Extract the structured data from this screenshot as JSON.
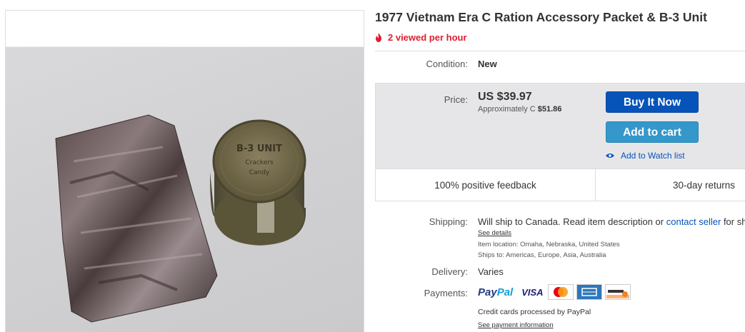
{
  "listing": {
    "title": "1977 Vietnam Era C Ration Accessory Packet & B-3 Unit",
    "views": "2 viewed per hour"
  },
  "condition": {
    "label": "Condition:",
    "value": "New"
  },
  "price": {
    "label": "Price:",
    "main": "US $39.97",
    "approx_prefix": "Approximately C ",
    "approx_value": "$51.86"
  },
  "actions": {
    "buy_now": "Buy It Now",
    "add_to_cart": "Add to cart",
    "watch": "Add to Watch list"
  },
  "highlights": {
    "feedback": "100% positive feedback",
    "returns": "30-day returns"
  },
  "shipping": {
    "label": "Shipping:",
    "text": "Will ship to Canada. Read item description or ",
    "contact_link": "contact seller",
    "text_after": " for sh",
    "see_details": "See details",
    "item_location": "Item location:  Omaha, Nebraska, United States",
    "ships_to": "Ships to:  Americas, Europe, Asia, Australia"
  },
  "delivery": {
    "label": "Delivery:",
    "value": "Varies"
  },
  "payments": {
    "label": "Payments:",
    "paypal_a": "Pay",
    "paypal_b": "Pal",
    "visa": "VISA",
    "note": "Credit cards processed by PayPal",
    "see_info": "See payment information"
  },
  "photo": {
    "can_text_1": "B-3 UNIT",
    "can_text_2": "Crackers",
    "can_text_3": "Candy"
  },
  "colors": {
    "buy_button": "#0654ba",
    "cart_button": "#3498ca",
    "link": "#0654ba",
    "views_red": "#dd1e31"
  }
}
